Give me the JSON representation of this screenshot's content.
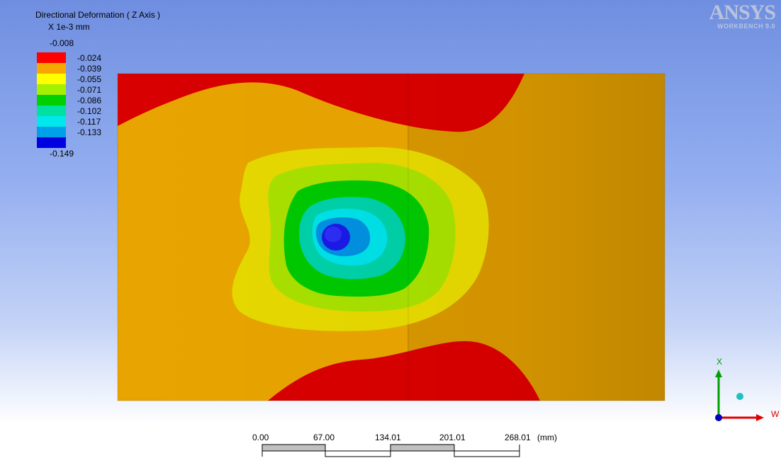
{
  "branding": {
    "logo": "ANSYS",
    "sublabel": "WORKBENCH 9.0"
  },
  "result": {
    "title": "Directional Deformation ( Z Axis )",
    "units": "X 1e-3 mm",
    "max_label": "-0.008",
    "min_label": "-0.149",
    "bands": [
      {
        "label": "-0.024",
        "color": "#ff0000"
      },
      {
        "label": "-0.039",
        "color": "#f7a800"
      },
      {
        "label": "-0.055",
        "color": "#ffff00"
      },
      {
        "label": "-0.071",
        "color": "#a4f000"
      },
      {
        "label": "-0.086",
        "color": "#00d000"
      },
      {
        "label": "-0.102",
        "color": "#00e0a0"
      },
      {
        "label": "-0.117",
        "color": "#00e8ee"
      },
      {
        "label": "-0.133",
        "color": "#00a0e8"
      },
      {
        "label": "",
        "color": "#0000e0"
      }
    ]
  },
  "scale_bar": {
    "ticks": [
      "0.00",
      "67.00",
      "134.01",
      "201.01",
      "268.01"
    ],
    "unit": "(mm)"
  },
  "triad": {
    "x_label": "X",
    "w_label": "W",
    "x_color": "#00a000",
    "w_color": "#e00000",
    "origin_color": "#0000c0",
    "iso_color": "#20c0c0"
  }
}
